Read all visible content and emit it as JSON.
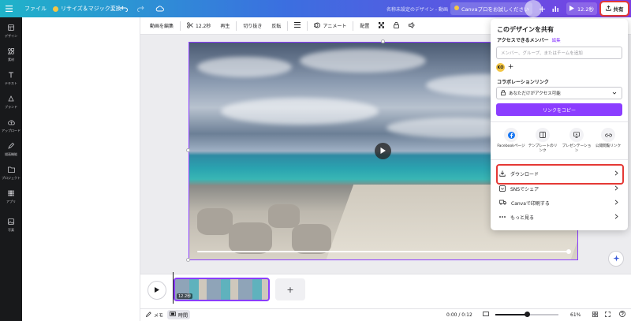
{
  "topbar": {
    "menu_icon": "hamburger-icon",
    "file_label": "ファイル",
    "resize_label": "リサイズ＆マジック変換",
    "doc_title": "名称未設定のデザイン - 動画",
    "pro_label": "Canvaプロをお試しください",
    "duration_label": "12.2秒",
    "share_label": "共有",
    "brand_gradient": [
      "#1fb3c9",
      "#3b6fe0",
      "#7b3fe4"
    ]
  },
  "rail": {
    "items": [
      {
        "icon": "layout-icon",
        "label": "デザイン"
      },
      {
        "icon": "elements-icon",
        "label": "素材"
      },
      {
        "icon": "text-icon",
        "label": "テキスト"
      },
      {
        "icon": "brand-icon",
        "label": "ブランド"
      },
      {
        "icon": "upload-icon",
        "label": "アップロード"
      },
      {
        "icon": "draw-icon",
        "label": "描画機能"
      },
      {
        "icon": "folder-icon",
        "label": "プロジェクト"
      },
      {
        "icon": "apps-icon",
        "label": "アプリ"
      },
      {
        "icon": "photo-icon",
        "label": "写真"
      }
    ]
  },
  "context_toolbar": {
    "edit_video": "動画を編集",
    "trim_duration": "12.2秒",
    "playback": "再生",
    "crop": "切り抜き",
    "flip": "反転",
    "animate": "アニメート",
    "position": "配置"
  },
  "share_panel": {
    "title": "このデザインを共有",
    "access_label": "アクセスできるメンバー",
    "edit_link": "編集",
    "invite_placeholder": "メンバー、グループ、またはチームを追加",
    "avatar_initials": "KO",
    "collab_label": "コラボレーションリンク",
    "access_value": "あなただけがアクセス可能",
    "copy_link": "リンクをコピー",
    "share_options": [
      {
        "icon": "facebook-icon",
        "label": "Facebookページ"
      },
      {
        "icon": "template-link-icon",
        "label": "テンプレートのリンク"
      },
      {
        "icon": "presentation-icon",
        "label": "プレゼンテーション"
      },
      {
        "icon": "public-link-icon",
        "label": "公開閲覧リンク"
      }
    ],
    "actions": [
      {
        "icon": "download-icon",
        "label": "ダウンロード"
      },
      {
        "icon": "sns-icon",
        "label": "SNSでシェア"
      },
      {
        "icon": "print-truck-icon",
        "label": "Canvaで印刷する"
      },
      {
        "icon": "more-icon",
        "label": "もっと見る"
      }
    ],
    "accent": "#8b3dff",
    "highlight": "#e53935"
  },
  "timeline": {
    "clip_duration": "12.2秒"
  },
  "bottombar": {
    "notes": "メモ",
    "time_toggle": "時間",
    "timecode": "0:00 / 0:12",
    "zoom": "61%",
    "zoom_fraction": 0.5
  }
}
